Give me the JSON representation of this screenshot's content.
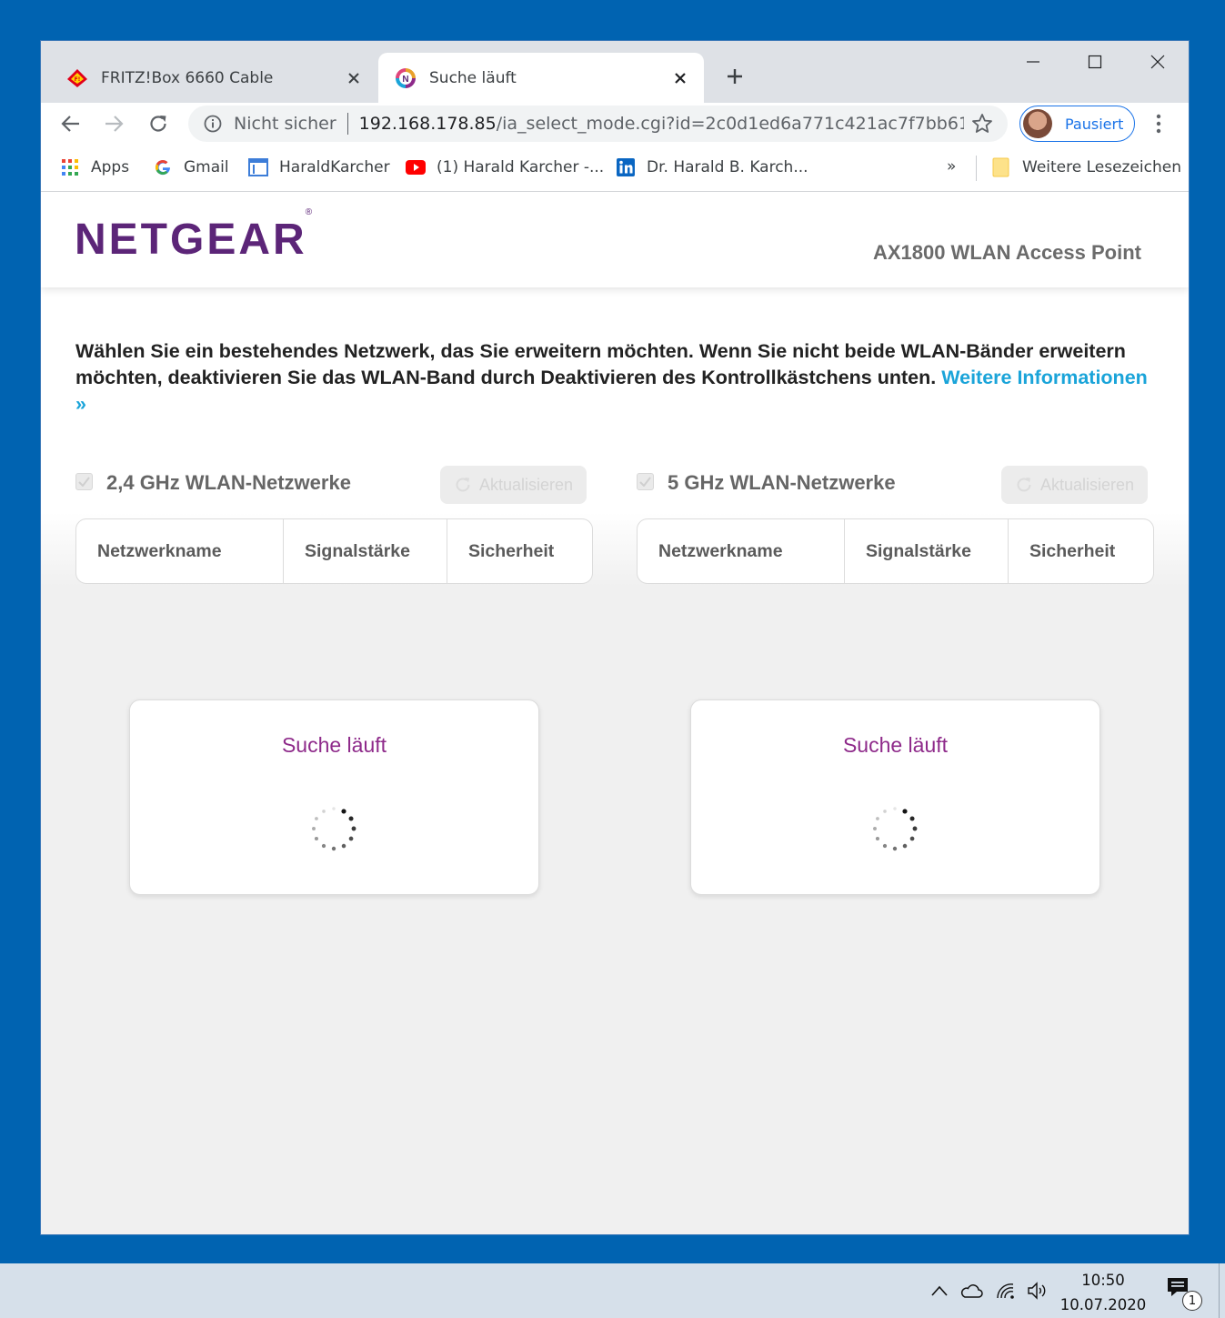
{
  "browser": {
    "tabs": [
      {
        "title": "FRITZ!Box 6660 Cable",
        "active": false,
        "favicon": "fritz-icon"
      },
      {
        "title": "Suche läuft",
        "active": true,
        "favicon": "netgear-icon"
      }
    ],
    "address_bar": {
      "security_label": "Nicht sicher",
      "url_host": "192.168.178.85",
      "url_path": "/ia_select_mode.cgi?id=2c0d1ed6a771c421ac7f7bb61..."
    },
    "profile_label": "Pausiert",
    "bookmarks": [
      {
        "label": "Apps",
        "icon": "apps-grid-icon"
      },
      {
        "label": "Gmail",
        "icon": "google-icon"
      },
      {
        "label": "HaraldKarcher",
        "icon": "page-icon"
      },
      {
        "label": "(1) Harald Karcher -...",
        "icon": "youtube-icon"
      },
      {
        "label": "Dr. Harald B. Karch...",
        "icon": "linkedin-icon"
      }
    ],
    "bookmarks_more": "»",
    "other_bookmarks": "Weitere Lesezeichen",
    "accent_color": "#1a73e8"
  },
  "page": {
    "logo": "NETGEAR",
    "logo_mark": "®",
    "product_name": "AX1800 WLAN Access Point",
    "intro_text": "Wählen Sie ein bestehendes Netzwerk, das Sie erweitern möchten. Wenn Sie nicht beide WLAN-Bänder erweitern möchten, deaktivieren Sie das WLAN-Band durch Deaktivieren des Kontrollkästchens unten. ",
    "more_info_link": "Weitere Informationen »",
    "refresh_label": "Aktualisieren",
    "bands": [
      {
        "title": "2,4 GHz WLAN-Netzwerke",
        "checked": true,
        "columns": [
          "Netzwerkname",
          "Signalstärke",
          "Sicherheit"
        ],
        "status": "Suche läuft"
      },
      {
        "title": "5 GHz WLAN-Netzwerke",
        "checked": true,
        "columns": [
          "Netzwerkname",
          "Signalstärke",
          "Sicherheit"
        ],
        "status": "Suche läuft"
      }
    ],
    "colors": {
      "brand_purple": "#5c2578",
      "status_purple": "#8e2a8a",
      "link_blue": "#1aa4d9"
    }
  },
  "taskbar": {
    "time": "10:50",
    "date": "10.07.2020",
    "notification_count": "1"
  }
}
